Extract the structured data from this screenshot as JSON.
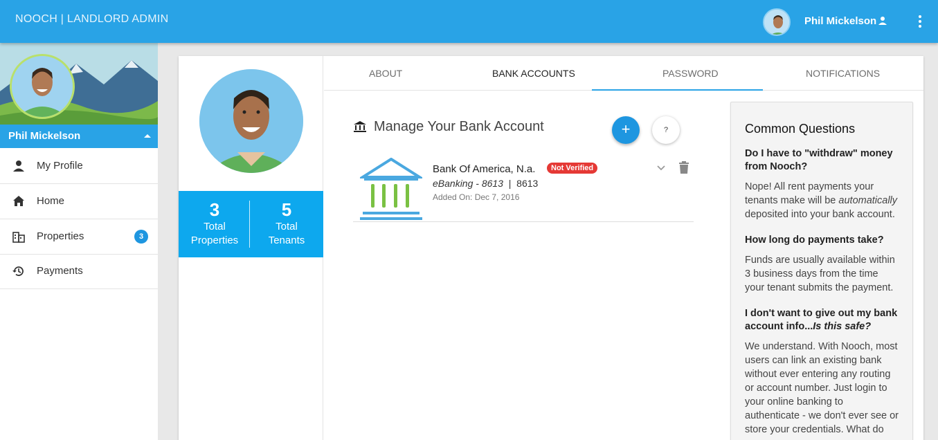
{
  "header": {
    "brand": "NOOCH | LANDLORD ADMIN",
    "user_name": "Phil Mickelson",
    "accent": "#29a3e6"
  },
  "sidebar": {
    "user_name": "Phil Mickelson",
    "items": [
      {
        "label": "My Profile",
        "icon": "person-icon"
      },
      {
        "label": "Home",
        "icon": "home-icon"
      },
      {
        "label": "Properties",
        "icon": "building-icon",
        "badge": "3"
      },
      {
        "label": "Payments",
        "icon": "history-icon"
      }
    ]
  },
  "profile": {
    "stats": [
      {
        "value": "3",
        "label_line1": "Total",
        "label_line2": "Properties"
      },
      {
        "value": "5",
        "label_line1": "Total",
        "label_line2": "Tenants"
      }
    ]
  },
  "tabs": [
    {
      "label": "ABOUT",
      "active": false
    },
    {
      "label": "BANK ACCOUNTS",
      "active": true
    },
    {
      "label": "PASSWORD",
      "active": false
    },
    {
      "label": "NOTIFICATIONS",
      "active": false
    }
  ],
  "bank_section": {
    "title": "Manage Your Bank Account",
    "add_label": "+",
    "help_label": "?",
    "account": {
      "name": "Bank Of America, N.a.",
      "status": "Not Verified",
      "nickname": "eBanking - 8613",
      "separator": "|",
      "last4": "8613",
      "added_on": "Added On: Dec 7, 2016"
    }
  },
  "faq": {
    "title": "Common Questions",
    "q1": "Do I have to \"withdraw\" money from Nooch?",
    "a1_part1": "Nope! All rent payments your tenants make will be ",
    "a1_em": "automatically",
    "a1_part2": " deposited into your bank account.",
    "q2": "How long do payments take?",
    "a2": "Funds are usually available within 3 business days from the time your tenant submits the payment.",
    "q3_part1": "I don't want to give out my bank account info...",
    "q3_em": "Is this safe?",
    "a3": "We understand. With Nooch, most users can link an existing bank without ever entering any routing or account number. Just login to your online banking to authenticate - we don't ever see or store your credentials. What do"
  }
}
